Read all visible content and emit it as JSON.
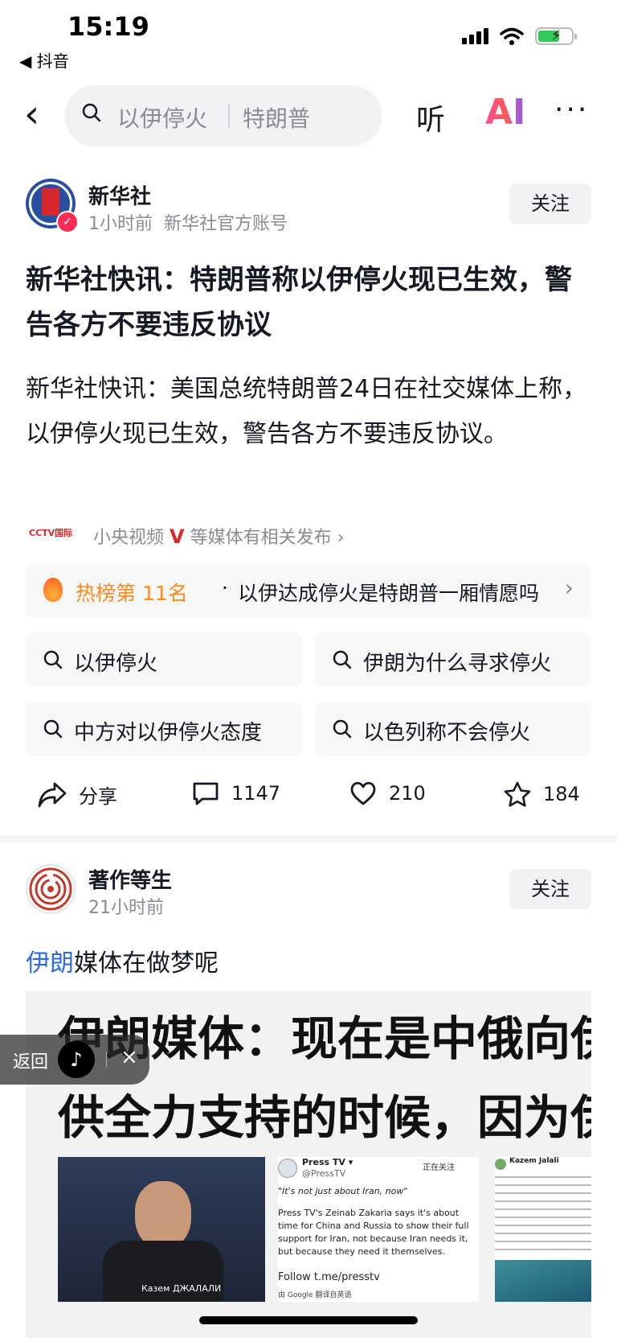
{
  "status_bar": {
    "time": "15:19",
    "back_app": "◀ 抖音"
  },
  "nav": {
    "back_icon": "chevron-left-icon",
    "search_query_1": "以伊停火",
    "search_query_2": "特朗普",
    "listen_label": "听",
    "ai_label": "AI",
    "more_label": "···"
  },
  "post1": {
    "author": "新华社",
    "time": "1小时前",
    "account_desc": "新华社官方账号",
    "follow_label": "关注",
    "title": "新华社快讯：特朗普称以伊停火现已生效，警告各方不要违反协议",
    "body": "新华社快讯：美国总统特朗普24日在社交媒体上称，以伊停火现已生效，警告各方不要违反协议。",
    "source_logo_text": "CCTV国际",
    "source_name": "小央视频",
    "source_verified": "V",
    "source_suffix": "等媒体有相关发布 ›",
    "hot": {
      "rank": "热榜第 11名",
      "dot": "·",
      "topic": "以伊达成停火是特朗普一厢情愿吗",
      "chevron": "›"
    },
    "suggestions": [
      "以伊停火",
      "伊朗为什么寻求停火",
      "中方对以伊停火态度",
      "以色列称不会停火"
    ],
    "actions": {
      "share_label": "分享",
      "comments": "1147",
      "likes": "210",
      "favorites": "184"
    }
  },
  "post2": {
    "author": "著作等生",
    "time": "21小时前",
    "follow_label": "关注",
    "text_highlight": "伊朗",
    "text_rest": "媒体在做梦呢",
    "image": {
      "headline_1": "伊朗媒体：现在是中俄向伊",
      "headline_2": "供全力支持的时候，因为伊",
      "photo_caption": "Казем ДЖАЛАЛИ",
      "tweet_name": "Press TV ▾",
      "tweet_handle": "@PressTV",
      "tweet_follow": "正在关注",
      "tweet_quote": "\"It's not just about Iran, now\"",
      "tweet_body": "Press TV's Zeinab Zakaria says it's about time for China and Russia to show their full support for Iran, not because Iran needs it, but because they need it themselves.",
      "tweet_link": "Follow t.me/presstv",
      "tweet_translate": "由 Google 翻译自英语",
      "tweet2_name": "Kazem Jalali"
    }
  },
  "floating": {
    "return_label": "返回",
    "close_label": "×"
  }
}
